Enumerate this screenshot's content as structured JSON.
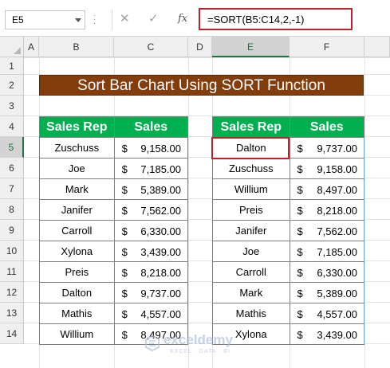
{
  "formula_bar": {
    "name_box": "E5",
    "cancel_icon": "✕",
    "enter_icon": "✓",
    "fx_label": "fx",
    "formula": "=SORT(B5:C14,2,-1)"
  },
  "columns": [
    "A",
    "B",
    "C",
    "D",
    "E",
    "F"
  ],
  "selected_column": "E",
  "rows": [
    "1",
    "2",
    "3",
    "4",
    "5",
    "6",
    "7",
    "8",
    "9",
    "10",
    "11",
    "12",
    "13",
    "14"
  ],
  "selected_row": "5",
  "title": "Sort Bar Chart Using SORT Function",
  "source_table": {
    "headers": [
      "Sales Rep",
      "Sales"
    ],
    "rows": [
      {
        "rep": "Zuschuss",
        "cur": "$",
        "sales": "9,158.00"
      },
      {
        "rep": "Joe",
        "cur": "$",
        "sales": "7,185.00"
      },
      {
        "rep": "Mark",
        "cur": "$",
        "sales": "5,389.00"
      },
      {
        "rep": "Janifer",
        "cur": "$",
        "sales": "7,562.00"
      },
      {
        "rep": "Carroll",
        "cur": "$",
        "sales": "6,330.00"
      },
      {
        "rep": "Xylona",
        "cur": "$",
        "sales": "3,439.00"
      },
      {
        "rep": "Preis",
        "cur": "$",
        "sales": "8,218.00"
      },
      {
        "rep": "Dalton",
        "cur": "$",
        "sales": "9,737.00"
      },
      {
        "rep": "Mathis",
        "cur": "$",
        "sales": "4,557.00"
      },
      {
        "rep": "Willium",
        "cur": "$",
        "sales": "8,497.00"
      }
    ]
  },
  "sorted_table": {
    "headers": [
      "Sales Rep",
      "Sales"
    ],
    "rows": [
      {
        "rep": "Dalton",
        "cur": "$",
        "sales": "9,737.00"
      },
      {
        "rep": "Zuschuss",
        "cur": "$",
        "sales": "9,158.00"
      },
      {
        "rep": "Willium",
        "cur": "$",
        "sales": "8,497.00"
      },
      {
        "rep": "Preis",
        "cur": "$",
        "sales": "8,218.00"
      },
      {
        "rep": "Janifer",
        "cur": "$",
        "sales": "7,562.00"
      },
      {
        "rep": "Joe",
        "cur": "$",
        "sales": "7,185.00"
      },
      {
        "rep": "Carroll",
        "cur": "$",
        "sales": "6,330.00"
      },
      {
        "rep": "Mark",
        "cur": "$",
        "sales": "5,389.00"
      },
      {
        "rep": "Mathis",
        "cur": "$",
        "sales": "4,557.00"
      },
      {
        "rep": "Xylona",
        "cur": "$",
        "sales": "3,439.00"
      }
    ]
  },
  "watermark": {
    "title": "exceldemy",
    "subtitle": "EXCEL · DATA · BI"
  },
  "colors": {
    "title_bg": "#833c0b",
    "header_bg": "#00b050",
    "active_border": "#c0202a",
    "selection": "#217346"
  }
}
